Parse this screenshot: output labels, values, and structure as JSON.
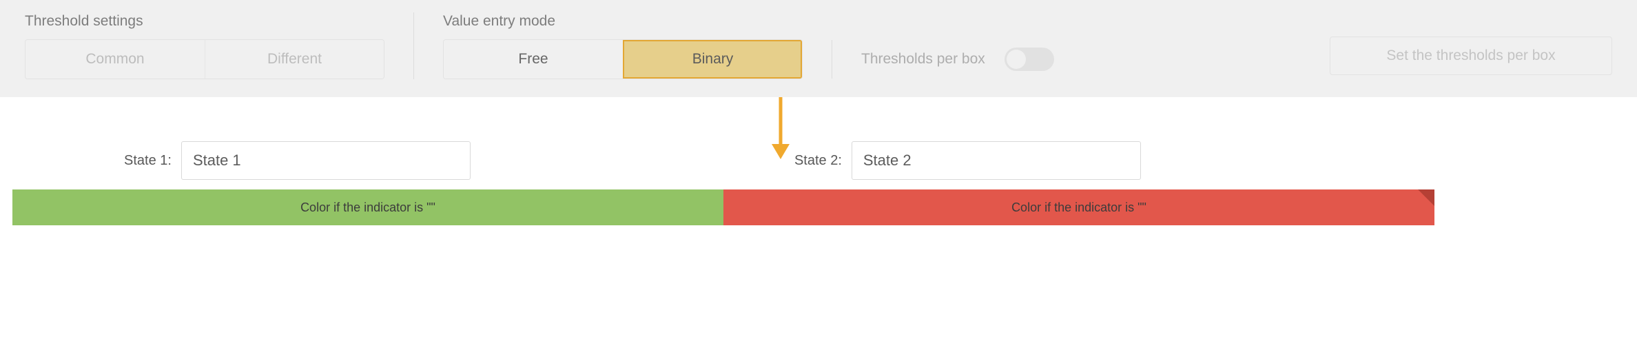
{
  "threshold_settings": {
    "title": "Threshold settings",
    "common": "Common",
    "different": "Different"
  },
  "value_entry_mode": {
    "title": "Value entry mode",
    "free": "Free",
    "binary": "Binary"
  },
  "thresholds_per_box": {
    "label": "Thresholds per box",
    "enabled": false,
    "set_button": "Set the thresholds per box"
  },
  "states": {
    "state1": {
      "label": "State 1:",
      "value": "State 1"
    },
    "state2": {
      "label": "State 2:",
      "value": "State 2"
    }
  },
  "color_bars": {
    "left": "Color if the indicator is \"\"",
    "right": "Color if the indicator is \"\""
  },
  "colors": {
    "green": "#92c365",
    "red": "#e2574b",
    "highlight_fill": "#e6cf8b",
    "highlight_border": "#e3a734",
    "arrow": "#f0a92e"
  }
}
